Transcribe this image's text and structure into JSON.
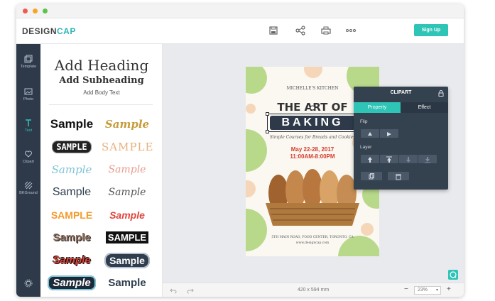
{
  "app": {
    "logo_main": "DESIGN",
    "logo_accent": "CAP",
    "signup_label": "Sign Up",
    "toolbar_icons": [
      "save-icon",
      "share-icon",
      "print-icon",
      "more-icon"
    ]
  },
  "colors": {
    "accent": "#2ec4b6",
    "nav_bg": "#2e3a4a",
    "panel_dark": "#34414f",
    "poster_green": "#b8d98a",
    "poster_peach": "#f6d6b8",
    "poster_red": "#d63b2a"
  },
  "nav": {
    "items": [
      {
        "label": "Template",
        "icon": "template-icon"
      },
      {
        "label": "Photo",
        "icon": "photo-icon"
      },
      {
        "label": "Text",
        "icon": "text-icon"
      },
      {
        "label": "Clipart",
        "icon": "heart-icon"
      },
      {
        "label": "BKGround",
        "icon": "background-icon"
      }
    ],
    "settings_icon": "gear-icon"
  },
  "text_panel": {
    "heading": "Add Heading",
    "subheading": "Add Subheading",
    "body": "Add Body Text",
    "samples": [
      "Sample",
      "Sample",
      "SAMPLE",
      "SAMPLE",
      "Sample",
      "Sample",
      "Sample",
      "Sample",
      "SAMPLE",
      "Sample",
      "Sample",
      "SAMPLE",
      "Sample",
      "Sample",
      "Sample",
      "Sample"
    ]
  },
  "poster": {
    "brand": "MICHELLE'S KITCHEN",
    "title_line1": "THE ART OF",
    "title_line2": "BAKING",
    "subtitle": "Simple Courses for Breads and Cookies",
    "date": "May 22-28, 2017",
    "time": "11:00AM-8:00PM",
    "address": "5TH MAIN ROAD, FOOD CENTER, TORONTO, CA",
    "website": "www.designcap.com"
  },
  "clipart_panel": {
    "title": "CLIPART",
    "tabs": [
      "Property",
      "Effect"
    ],
    "active_tab": "Property",
    "flip_label": "Flip",
    "layer_label": "Layer"
  },
  "footer": {
    "canvas_size": "420 x 594 mm",
    "zoom": "23%",
    "zoom_out": "−",
    "zoom_in": "+"
  }
}
